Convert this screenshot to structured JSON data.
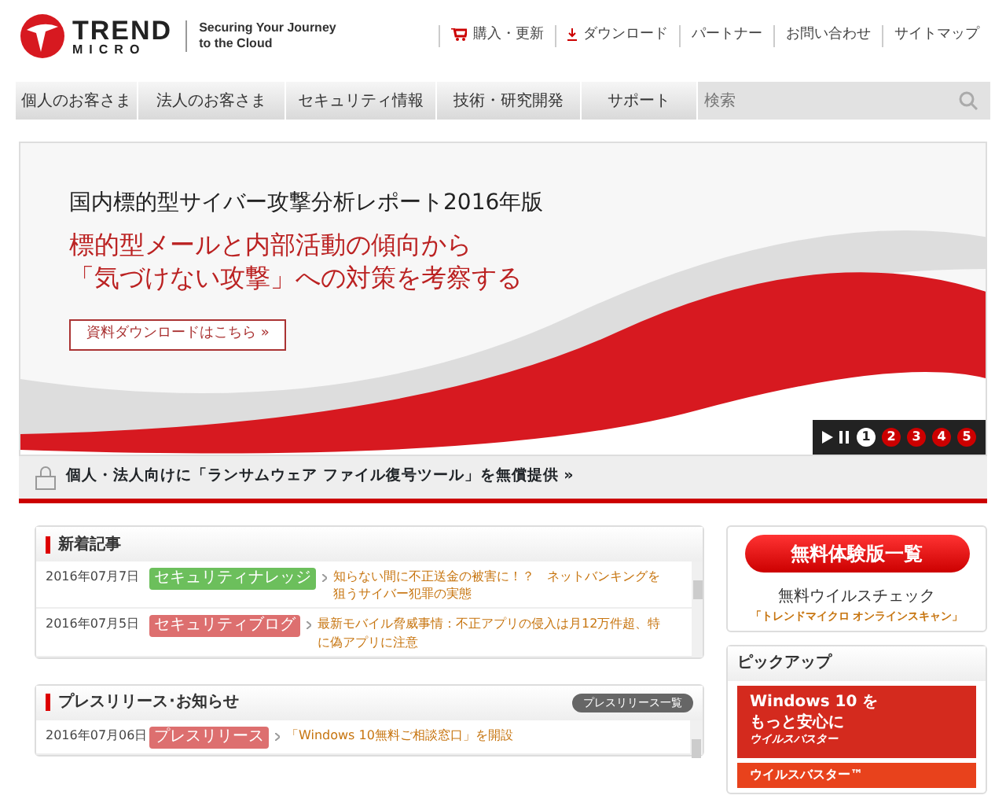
{
  "header": {
    "logo_line1": "TREND",
    "logo_line2": "MICRO",
    "tagline": "Securing Your Journey to the Cloud",
    "links": [
      {
        "label": "購入・更新",
        "kind": "cart"
      },
      {
        "label": "ダウンロード",
        "kind": "download"
      },
      {
        "label": "パートナー",
        "kind": "plain"
      },
      {
        "label": "お問い合わせ",
        "kind": "plain"
      },
      {
        "label": "サイトマップ",
        "kind": "plain"
      }
    ]
  },
  "nav": {
    "items": [
      "個人のお客さま",
      "法人のお客さま",
      "セキュリティ情報",
      "技術・研究開発",
      "サポート"
    ],
    "search": {
      "placeholder": "検索"
    }
  },
  "hero": {
    "title": "国内標的型サイバー攻撃分析レポート2016年版",
    "subtitle_1": "標的型メールと内部活動の傾向から",
    "subtitle_2": "「気づけない攻撃」への対策を考察する",
    "button": "資料ダウンロードはこちら »",
    "slides": [
      {
        "label": "1",
        "selected": true
      },
      {
        "label": "2",
        "selected": false
      },
      {
        "label": "3",
        "selected": false
      },
      {
        "label": "4",
        "selected": false
      },
      {
        "label": "5",
        "selected": false
      }
    ]
  },
  "notice": "個人・法人向けに「ランサムウェア ファイル復号ツール」を無償提供 »",
  "news": {
    "title": "新着記事",
    "rows": [
      {
        "date": "2016年07月7日",
        "tag": "セキュリティナレッジ",
        "color": "#6cbf5c",
        "text": "知らない間に不正送金の被害に！？　ネットバンキングを狙うサイバー犯罪の実態"
      },
      {
        "date": "2016年07月5日",
        "tag": "セキュリティブログ",
        "color": "#dd6f6f",
        "text": "最新モバイル脅威事情：不正アプリの侵入は月12万件超、特に偽アプリに注意"
      }
    ]
  },
  "press": {
    "title": "プレスリリース･お知らせ",
    "button": "プレスリリース一覧",
    "rows": [
      {
        "date": "2016年07月06日",
        "tag": "プレスリリース",
        "color": "#dd6f6f",
        "text": "「Windows 10無料ご相談窓口」を開設"
      }
    ]
  },
  "trial": {
    "button": "無料体験版一覧",
    "caption": "無料ウイルスチェック",
    "link": "「トレンドマイクロ オンラインスキャン」"
  },
  "pickup": {
    "title": "ピックアップ",
    "banner_1": [
      "Windows 10 を",
      "もっと安心に",
      "ウイルスバスター"
    ],
    "banner_2": "ウイルスバスター™"
  }
}
